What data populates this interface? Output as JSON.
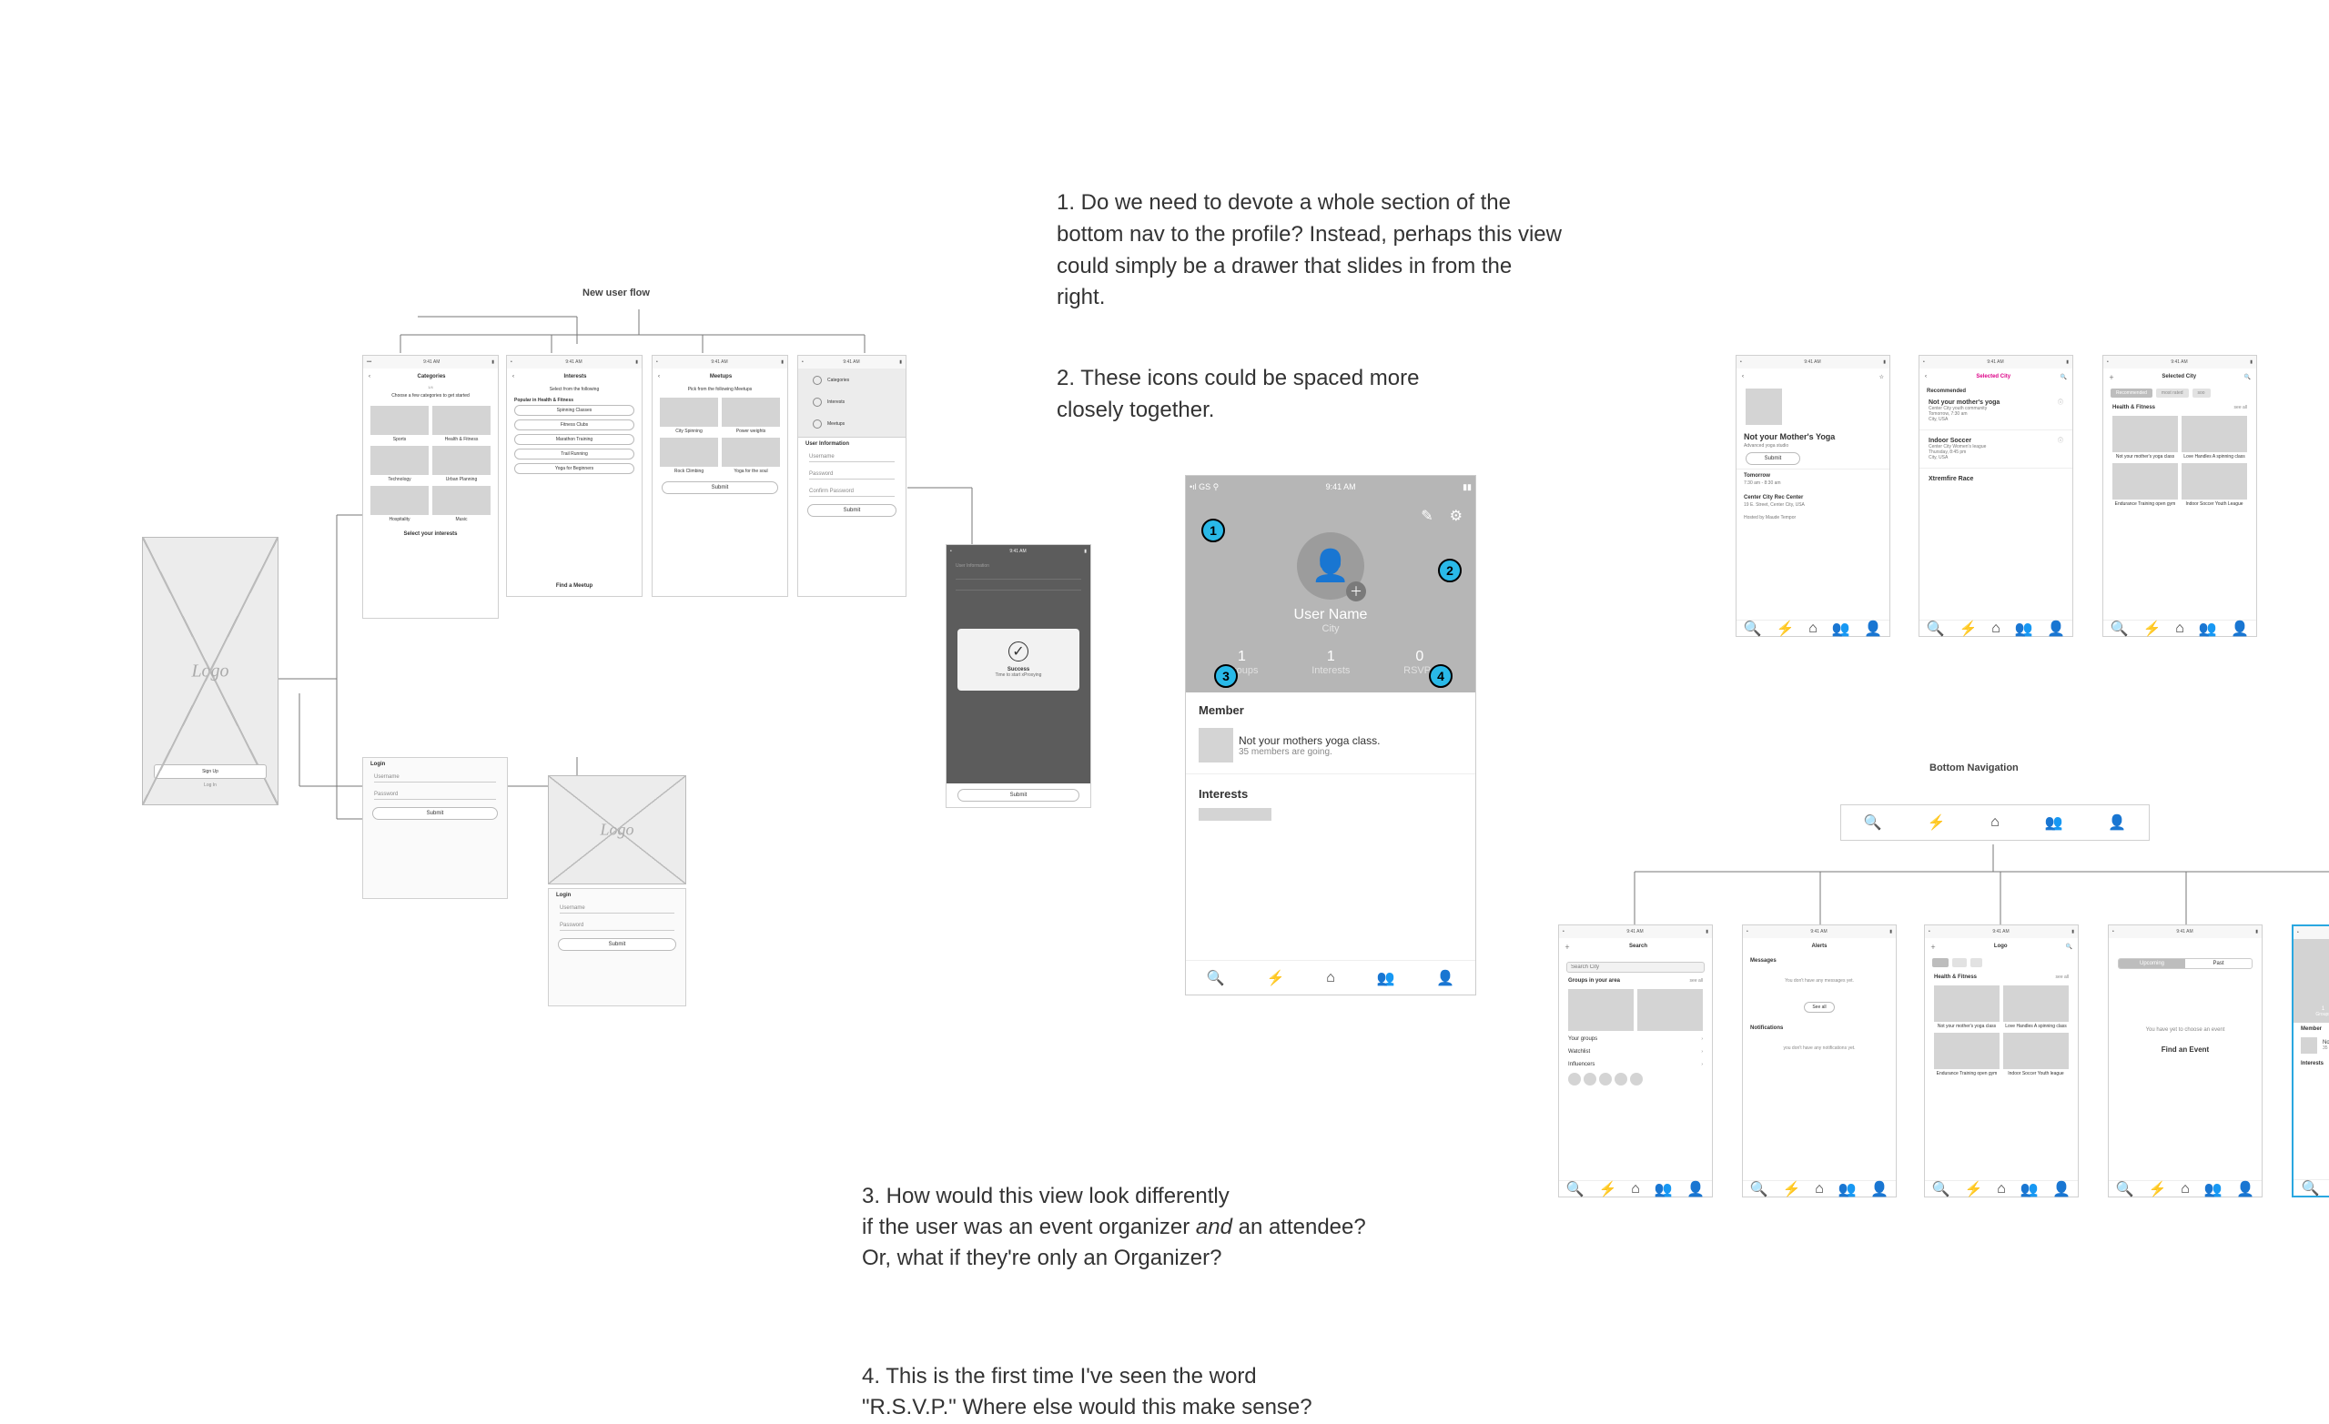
{
  "titles": {
    "new_user_flow": "New user flow",
    "bottom_nav": "Bottom Navigation"
  },
  "questions": {
    "q1": "1. Do we need to devote a whole section of the bottom nav to the profile? Instead, perhaps this view could simply be a drawer that slides in from the right.",
    "q2": "2. These icons could be spaced more closely together.",
    "q3a": "3. How would this view look differently",
    "q3b": "if the user was an event organizer ",
    "q3b_i": "and",
    "q3c": " an attendee?",
    "q3d": "Or, what if they're only an Organizer?",
    "q4a": "4. This is the first time I've seen the word",
    "q4b": "\"R.S.V.P.\" Where else would this make sense?"
  },
  "status": {
    "time": "9:41 AM",
    "carrier": "•••"
  },
  "splash": {
    "logo": "Logo",
    "signup": "Sign Up",
    "login": "Log In"
  },
  "login": {
    "title": "Login",
    "user": "Username",
    "pass": "Password",
    "submit": "Submit"
  },
  "categories": {
    "title": "Categories",
    "sub": "1/4",
    "prompt": "Choose a few categories to get started",
    "c": [
      "Sports",
      "Health & Fitness",
      "Technology",
      "Urban Planning",
      "Hospitality",
      "Music"
    ],
    "cta": "Select your interests"
  },
  "interests": {
    "title": "Interests",
    "prompt": "Select from the following",
    "group": "Popular in Health & Fitness",
    "opts": [
      "Spinning Classes",
      "Fitness Clubs",
      "Marathon Training",
      "Trail Running",
      "Yoga for Beginners"
    ],
    "cta": "Find a Meetup"
  },
  "meetups": {
    "title": "Meetups",
    "prompt": "Pick from the following Meetups",
    "names": [
      "City Spinning",
      "Power weights",
      "Rock Climbing",
      "Yoga for the soul"
    ],
    "cta": "Submit"
  },
  "userinfo": {
    "title": "User Information",
    "steps": [
      "Categories",
      "Interests",
      "Meetups",
      "User Information"
    ],
    "fields": [
      "Username",
      "Password",
      "Confirm Password"
    ],
    "cta": "Submit"
  },
  "success": {
    "title": "Success",
    "sub": "Time to start xProxying",
    "cta": "Submit"
  },
  "profile": {
    "name": "User Name",
    "city": "City",
    "stats": [
      {
        "n": "1",
        "l": "Groups"
      },
      {
        "n": "1",
        "l": "Interests"
      },
      {
        "n": "0",
        "l": "RSVPs"
      }
    ],
    "member": "Member",
    "yoga_title": "Not your mothers yoga class.",
    "yoga_sub": "35 members are going.",
    "interests": "Interests"
  },
  "event": {
    "title": "Not your Mother's Yoga",
    "sub": "Advanced yoga studio",
    "submit": "Submit",
    "tomorrow": "Tomorrow",
    "time": "7:30 am - 8:30 am",
    "venue": "Center City Rec Center",
    "addr": "19 E. Street, Center City, USA",
    "host": "Hosted by Maude Tempor"
  },
  "feed": {
    "title": "Selected City",
    "rec": "Recommended",
    "e1": {
      "t": "Not your mother's yoga",
      "s1": "Center City youth community",
      "s2": "Tomorrow, 7:30 am",
      "s3": "City, USA"
    },
    "e2": {
      "t": "Indoor Soccer",
      "s1": "Center City Women's league",
      "s2": "Thursday, 8:45 pm",
      "s3": "City, USA"
    },
    "e3": {
      "t": "Xtremfire Race"
    }
  },
  "home": {
    "title": "Selected City",
    "chip1": "Recommended",
    "chip2": "most rated",
    "chip3": "soo",
    "cat": "Health & Fitness",
    "seeall": "see all",
    "c": [
      "Not your mother's yoga class",
      "Love Handles A spinning class",
      "Endurance Training open gym",
      "Indoor Soccer Youth League"
    ]
  },
  "search": {
    "title": "Search",
    "placeholder": "Search City",
    "sec1": "Groups in your area",
    "seeall": "see all",
    "sec2": "Your groups",
    "sec3": "Watchlist",
    "sec4": "Influencers"
  },
  "alerts": {
    "title": "Alerts",
    "messages": "Messages",
    "empty1": "You don't have any messages yet.",
    "seeall": "See all",
    "not": "Notifications",
    "empty2": "you don't have any notifications yet."
  },
  "logof": {
    "title": "Logo",
    "cat": "Health & Fitness",
    "seeall": "see all",
    "c": [
      "Not your mother's yoga class",
      "Love Handles A spinning class",
      "Endurance Training open gym",
      "Indoor Soccer Youth league"
    ]
  },
  "upcoming": {
    "tabs": [
      "Upcoming",
      "Past"
    ],
    "empty": "You have yet to choose an event",
    "cta": "Find an Event"
  },
  "markers": [
    "1",
    "2",
    "3",
    "4"
  ]
}
